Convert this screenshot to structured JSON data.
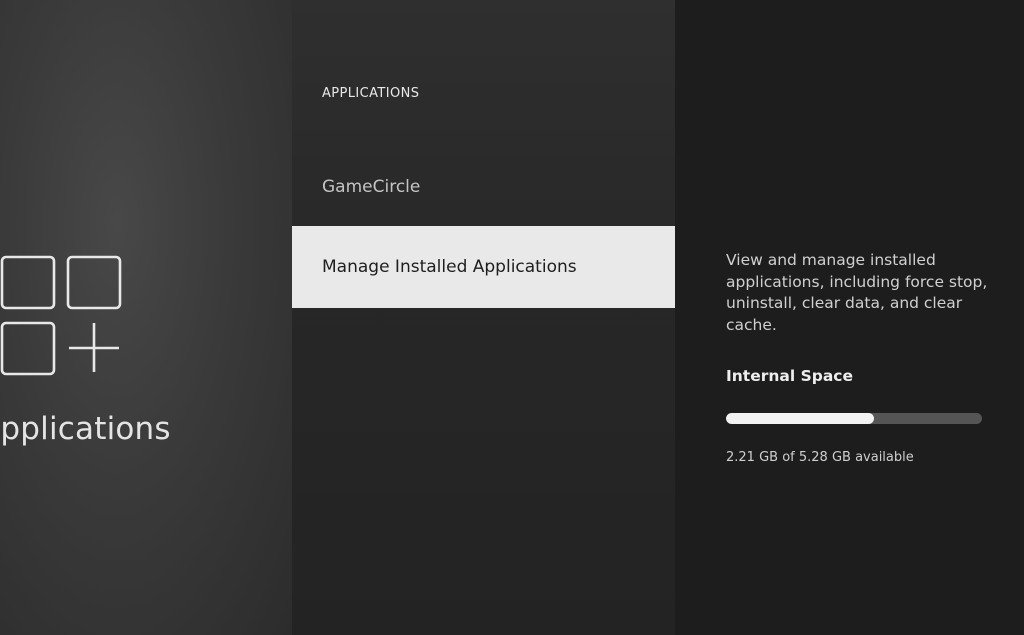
{
  "category": {
    "title": "Applications",
    "icon": "apps-grid-plus-icon"
  },
  "menu": {
    "header": "APPLICATIONS",
    "items": [
      {
        "label": "GameCircle",
        "selected": false
      },
      {
        "label": "Manage Installed Applications",
        "selected": true
      }
    ]
  },
  "detail": {
    "description": "View and manage installed applications, including force stop, uninstall, clear data, and clear cache.",
    "storage_title": "Internal Space",
    "storage_text": "2.21 GB of 5.28 GB available",
    "storage_used_fraction": 0.58
  },
  "colors": {
    "selected_bg": "#e9e9e9",
    "selected_text": "#1e1e1e",
    "bar_fill": "#f2f2f2",
    "bar_track": "#555555"
  }
}
